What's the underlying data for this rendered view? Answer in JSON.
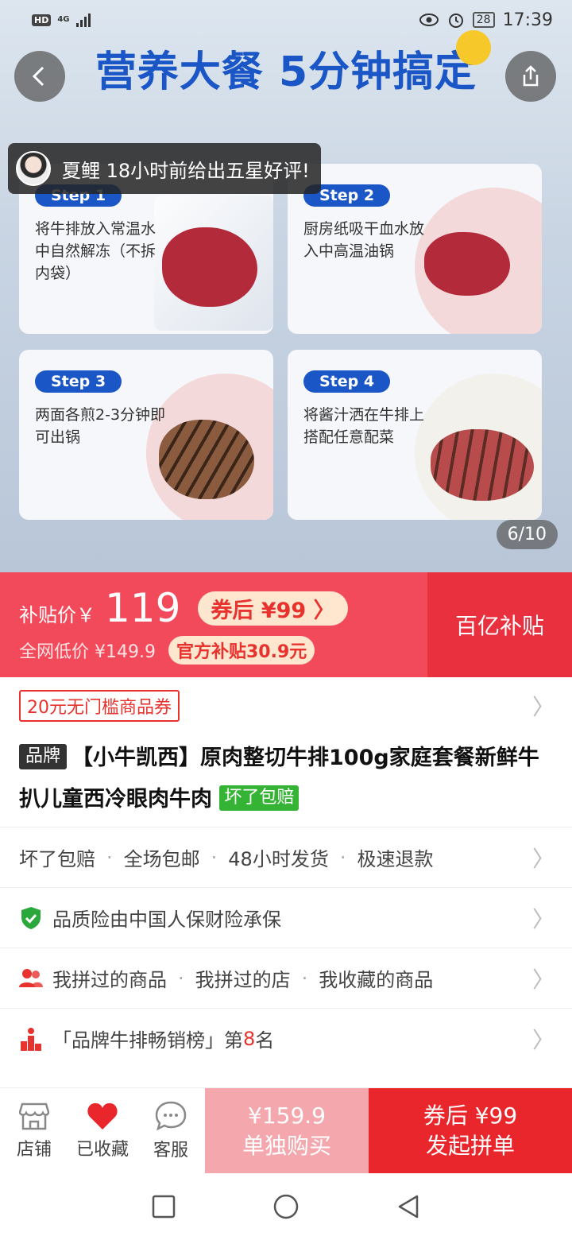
{
  "status_bar": {
    "hd": "HD",
    "network": "4G",
    "battery": "28",
    "time": "17:39"
  },
  "hero": {
    "title": "营养大餐 5分钟搞定",
    "review": {
      "user": "夏鲤",
      "text": "18小时前给出五星好评!"
    },
    "steps": [
      {
        "badge": "Step 1",
        "text": "将牛排放入常温水中自然解冻（不拆内袋）"
      },
      {
        "badge": "Step 2",
        "text": "厨房纸吸干血水放入中高温油锅"
      },
      {
        "badge": "Step 3",
        "text": "两面各煎2-3分钟即可出锅"
      },
      {
        "badge": "Step 4",
        "text": "将酱汁洒在牛排上搭配任意配菜"
      }
    ],
    "counter": "6/10"
  },
  "price_bar": {
    "subsidy_label": "补贴价￥",
    "price": "119",
    "coupon_price": "券后 ¥99 〉",
    "orig_label": "全网低价 ¥149.9",
    "official_subsidy": "官方补贴30.9元",
    "right_label": "百亿补贴"
  },
  "coupon": {
    "label": "20元无门槛商品券"
  },
  "product": {
    "brand_tag": "品牌",
    "title": "【小牛凯西】原肉整切牛排100g家庭套餐新鲜牛扒儿童西冷眼肉牛肉",
    "green_tag": "坏了包赔"
  },
  "services": [
    "坏了包赔",
    "全场包邮",
    "48小时发货",
    "极速退款"
  ],
  "insurance": "品质险由中国人保财险承保",
  "history": [
    "我拼过的商品",
    "我拼过的店",
    "我收藏的商品"
  ],
  "ranking": {
    "prefix": "「品牌牛排畅销榜」第",
    "rank": "8",
    "suffix": "名"
  },
  "action_bar": {
    "store": "店铺",
    "favorite": "已收藏",
    "service": "客服",
    "single_price": "¥159.9",
    "single_label": "单独购买",
    "group_price": "券后 ¥99",
    "group_label": "发起拼单"
  },
  "colors": {
    "brand_red": "#e8262b",
    "subsidy_red": "#f34a5b",
    "step_blue": "#1b56c7",
    "green": "#34b334"
  }
}
